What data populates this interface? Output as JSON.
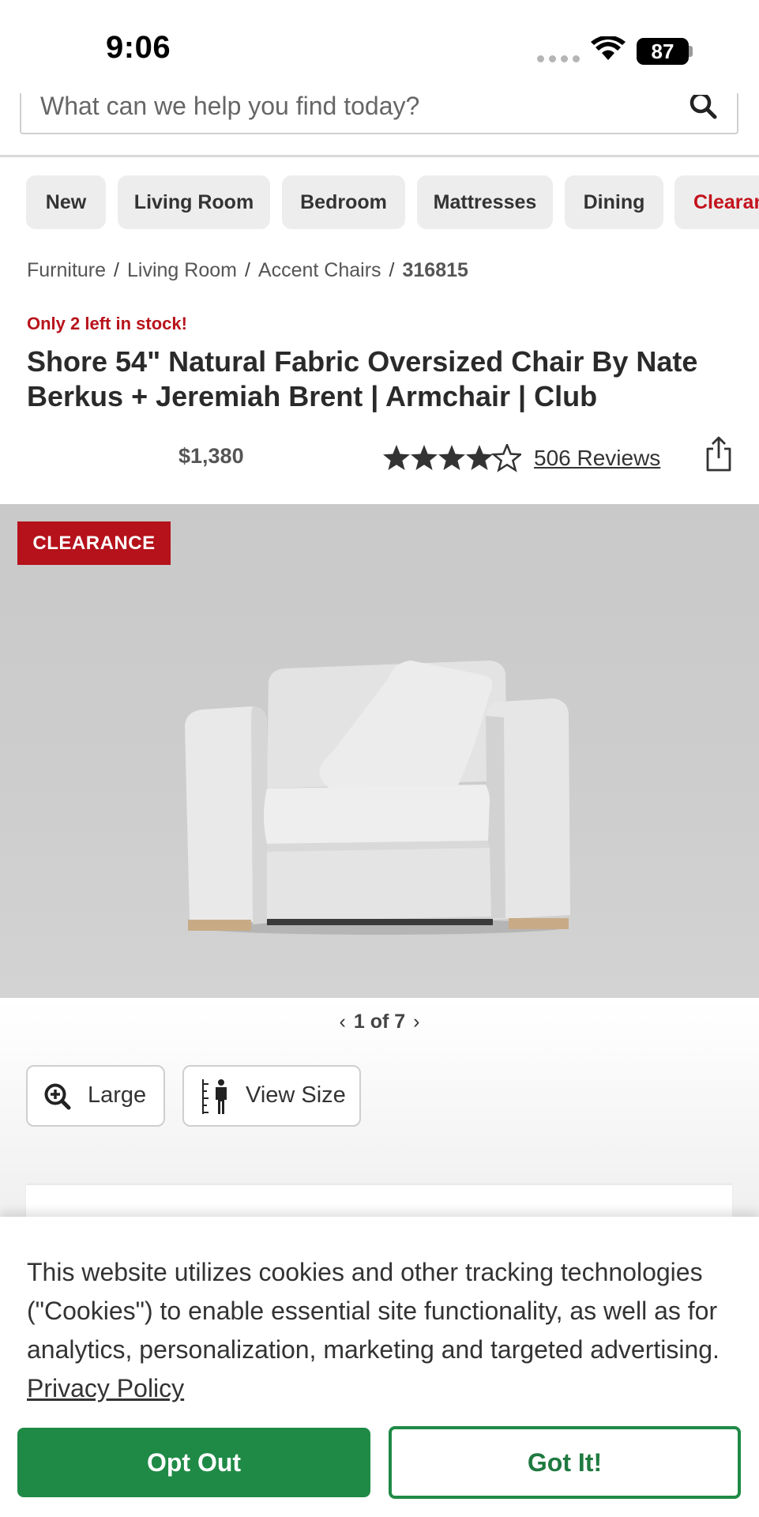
{
  "status_bar": {
    "time": "9:06",
    "battery": "87"
  },
  "search": {
    "placeholder": "What can we help you find today?"
  },
  "categories": [
    "New",
    "Living Room",
    "Bedroom",
    "Mattresses",
    "Dining",
    "Clearance"
  ],
  "breadcrumb": {
    "items": [
      "Furniture",
      "Living Room",
      "Accent Chairs"
    ],
    "sku": "316815"
  },
  "product": {
    "stock_note": "Only 2 left in stock!",
    "title": "Shore 54\" Natural Fabric Oversized Chair By Nate Berkus + Jeremiah Brent | Armchair | Club",
    "price": "$1,380",
    "rating": 4.5,
    "reviews_label": "506 Reviews",
    "badge": "CLEARANCE"
  },
  "gallery": {
    "current": "1",
    "total": "7",
    "label": "1 of 7"
  },
  "tools": {
    "large_label": "Large",
    "view_size_label": "View Size"
  },
  "cookie": {
    "text": "This website utilizes cookies and other tracking technologies (\"Cookies\") to enable essential site functionality, as well as for analytics, personalization, marketing and targeted advertising.",
    "link": "Privacy Policy",
    "opt_out": "Opt Out",
    "got_it": "Got It!"
  },
  "colors": {
    "accent_green": "#1f8a46",
    "clearance_red": "#b5121b"
  }
}
